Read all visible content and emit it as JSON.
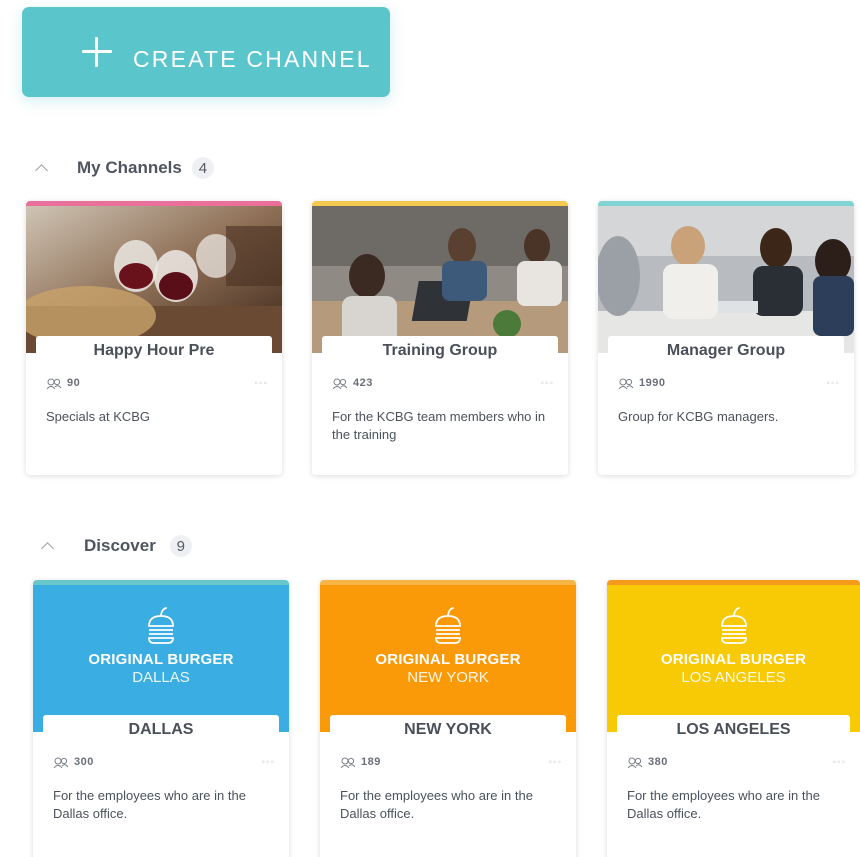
{
  "create_button": {
    "label": "CREATE CHANNEL",
    "icon": "plus-icon"
  },
  "my_channels": {
    "title": "My Channels",
    "count": "4",
    "cards": [
      {
        "name": "Happy Hour Pre",
        "members": "90",
        "description": "Specials at KCBG",
        "accent": "#e8709a",
        "scene": "wine-toast"
      },
      {
        "name": "Training Group",
        "members": "423",
        "description": "For the KCBG team members who in the training",
        "accent": "#f2c94c",
        "scene": "office-meeting"
      },
      {
        "name": "Manager Group",
        "members": "1990",
        "description": "Group for KCBG managers.",
        "accent": "#7fd4d1",
        "scene": "team-discussion"
      }
    ]
  },
  "discover": {
    "title": "Discover",
    "count": "9",
    "cards": [
      {
        "name": "DALLAS",
        "brand": "ORIGINAL BURGER",
        "brand_city": "DALLAS",
        "members": "300",
        "description": "For the employees who are in the Dallas office.",
        "bg": "#3aaee2",
        "accent": "#68c7c9"
      },
      {
        "name": "NEW YORK",
        "brand": "ORIGINAL BURGER",
        "brand_city": "NEW YORK",
        "members": "189",
        "description": "For the employees who are in the Dallas office.",
        "bg": "#fb9a08",
        "accent": "#f5b547"
      },
      {
        "name": "LOS ANGELES",
        "brand": "ORIGINAL BURGER",
        "brand_city": "LOS ANGELES",
        "members": "380",
        "description": "For the employees who are in the Dallas office.",
        "bg": "#f8c905",
        "accent": "#f59a1b"
      }
    ]
  },
  "icons": {
    "members": "members-icon",
    "more": "more-options-icon",
    "chevron": "chevron-up-icon",
    "logo": "burger-logo-icon"
  },
  "more_glyph": "◦◦◦"
}
